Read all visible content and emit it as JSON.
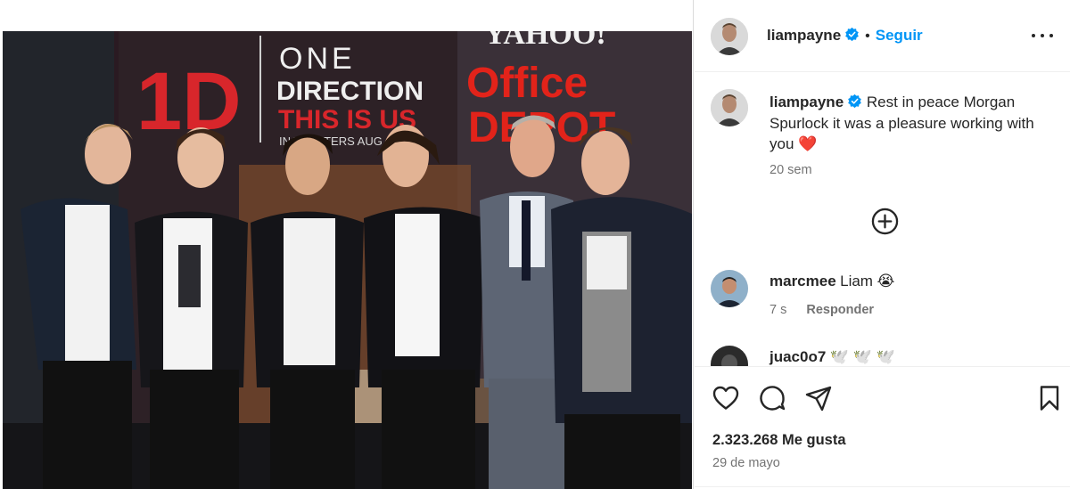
{
  "post": {
    "author": {
      "username": "liampayne",
      "verified": true,
      "follow_label": "Seguir",
      "separator": "•"
    },
    "photo": {
      "banner_logo": "1D",
      "banner_title_line1": "ONE",
      "banner_title_line2": "DIRECTION",
      "banner_title_line3": "THIS IS US",
      "banner_subtitle": "IN THEATERS AUG",
      "sponsor_top": "YAHOO!",
      "sponsor_line1": "Office",
      "sponsor_line2": "DEPOT"
    },
    "caption": {
      "username": "liampayne",
      "text": "Rest in peace Morgan Spurlock it was a pleasure working with you",
      "emoji": "❤️",
      "time": "20 sem"
    },
    "comments": [
      {
        "username": "marcmee",
        "text": "Liam",
        "emoji": "😭",
        "time": "7 s",
        "reply_label": "Responder"
      },
      {
        "username": "juac0o7",
        "text": "🕊️ 🕊️ 🕊️"
      }
    ],
    "likes": "2.323.268 Me gusta",
    "date": "29 de mayo"
  },
  "icons": {
    "more": "more-options-icon",
    "add": "add-comment-plus-icon",
    "like": "heart-icon",
    "comment": "comment-bubble-icon",
    "share": "paper-plane-icon",
    "save": "bookmark-icon",
    "verified": "verified-badge-icon"
  },
  "colors": {
    "link_blue": "#0095f6",
    "verified_blue": "#0095f6",
    "text_primary": "#262626",
    "text_secondary": "#737373",
    "heart_red": "#e0245e"
  }
}
